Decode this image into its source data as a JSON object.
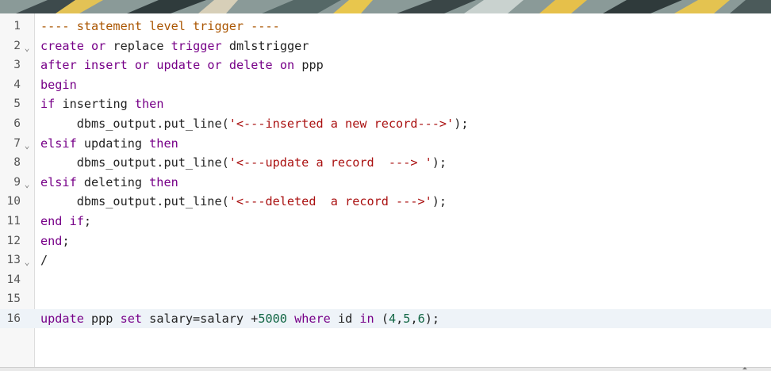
{
  "editor": {
    "lines": [
      {
        "num": "1",
        "fold": "",
        "segments": [
          {
            "t": "---- statement level trigger ----",
            "c": "cm"
          }
        ]
      },
      {
        "num": "2",
        "fold": "⌄",
        "segments": [
          {
            "t": "create",
            "c": "kw"
          },
          {
            "t": " ",
            "c": ""
          },
          {
            "t": "or",
            "c": "kw"
          },
          {
            "t": " ",
            "c": ""
          },
          {
            "t": "replace",
            "c": ""
          },
          {
            "t": " ",
            "c": ""
          },
          {
            "t": "trigger",
            "c": "kw"
          },
          {
            "t": " dmlstrigger",
            "c": ""
          }
        ]
      },
      {
        "num": "3",
        "fold": "",
        "segments": [
          {
            "t": "after",
            "c": "kw"
          },
          {
            "t": " ",
            "c": ""
          },
          {
            "t": "insert",
            "c": "kw"
          },
          {
            "t": " ",
            "c": ""
          },
          {
            "t": "or",
            "c": "kw"
          },
          {
            "t": " ",
            "c": ""
          },
          {
            "t": "update",
            "c": "kw"
          },
          {
            "t": " ",
            "c": ""
          },
          {
            "t": "or",
            "c": "kw"
          },
          {
            "t": " ",
            "c": ""
          },
          {
            "t": "delete",
            "c": "kw"
          },
          {
            "t": " ",
            "c": ""
          },
          {
            "t": "on",
            "c": "kw"
          },
          {
            "t": " ppp",
            "c": ""
          }
        ]
      },
      {
        "num": "4",
        "fold": "",
        "segments": [
          {
            "t": "begin",
            "c": "kw"
          }
        ]
      },
      {
        "num": "5",
        "fold": "",
        "segments": [
          {
            "t": "if",
            "c": "kw"
          },
          {
            "t": " inserting ",
            "c": ""
          },
          {
            "t": "then",
            "c": "kw"
          }
        ]
      },
      {
        "num": "6",
        "fold": "",
        "segments": [
          {
            "t": "     dbms_output.put_line(",
            "c": ""
          },
          {
            "t": "'<---inserted a new record--->'",
            "c": "st"
          },
          {
            "t": ");",
            "c": ""
          }
        ]
      },
      {
        "num": "7",
        "fold": "⌄",
        "segments": [
          {
            "t": "elsif",
            "c": "kw"
          },
          {
            "t": " updating ",
            "c": ""
          },
          {
            "t": "then",
            "c": "kw"
          }
        ]
      },
      {
        "num": "8",
        "fold": "",
        "segments": [
          {
            "t": "     dbms_output.put_line(",
            "c": ""
          },
          {
            "t": "'<---update a record  ---> '",
            "c": "st"
          },
          {
            "t": ");",
            "c": ""
          }
        ]
      },
      {
        "num": "9",
        "fold": "⌄",
        "segments": [
          {
            "t": "elsif",
            "c": "kw"
          },
          {
            "t": " deleting ",
            "c": ""
          },
          {
            "t": "then",
            "c": "kw"
          }
        ]
      },
      {
        "num": "10",
        "fold": "",
        "segments": [
          {
            "t": "     dbms_output.put_line(",
            "c": ""
          },
          {
            "t": "'<---deleted  a record --->'",
            "c": "st"
          },
          {
            "t": ");",
            "c": ""
          }
        ]
      },
      {
        "num": "11",
        "fold": "",
        "segments": [
          {
            "t": "end",
            "c": "kw"
          },
          {
            "t": " ",
            "c": ""
          },
          {
            "t": "if",
            "c": "kw"
          },
          {
            "t": ";",
            "c": ""
          }
        ]
      },
      {
        "num": "12",
        "fold": "",
        "segments": [
          {
            "t": "end",
            "c": "kw"
          },
          {
            "t": ";",
            "c": ""
          }
        ]
      },
      {
        "num": "13",
        "fold": "⌄",
        "segments": [
          {
            "t": "/",
            "c": ""
          }
        ]
      },
      {
        "num": "14",
        "fold": "",
        "segments": []
      },
      {
        "num": "15",
        "fold": "",
        "segments": []
      },
      {
        "num": "16",
        "fold": "",
        "active": true,
        "segments": [
          {
            "t": "update",
            "c": "kw"
          },
          {
            "t": " ppp ",
            "c": ""
          },
          {
            "t": "set",
            "c": "kw"
          },
          {
            "t": " salary=salary +",
            "c": ""
          },
          {
            "t": "5000",
            "c": "nm"
          },
          {
            "t": " ",
            "c": ""
          },
          {
            "t": "where",
            "c": "kw"
          },
          {
            "t": " id ",
            "c": ""
          },
          {
            "t": "in",
            "c": "kw"
          },
          {
            "t": " (",
            "c": ""
          },
          {
            "t": "4",
            "c": "nm"
          },
          {
            "t": ",",
            "c": ""
          },
          {
            "t": "5",
            "c": "nm"
          },
          {
            "t": ",",
            "c": ""
          },
          {
            "t": "6",
            "c": "nm"
          },
          {
            "t": ");",
            "c": ""
          }
        ]
      }
    ]
  },
  "colors": {
    "keyword": "#770088",
    "comment": "#aa5500",
    "string": "#aa1111",
    "number": "#116644",
    "active_line": "#eef3f8"
  }
}
